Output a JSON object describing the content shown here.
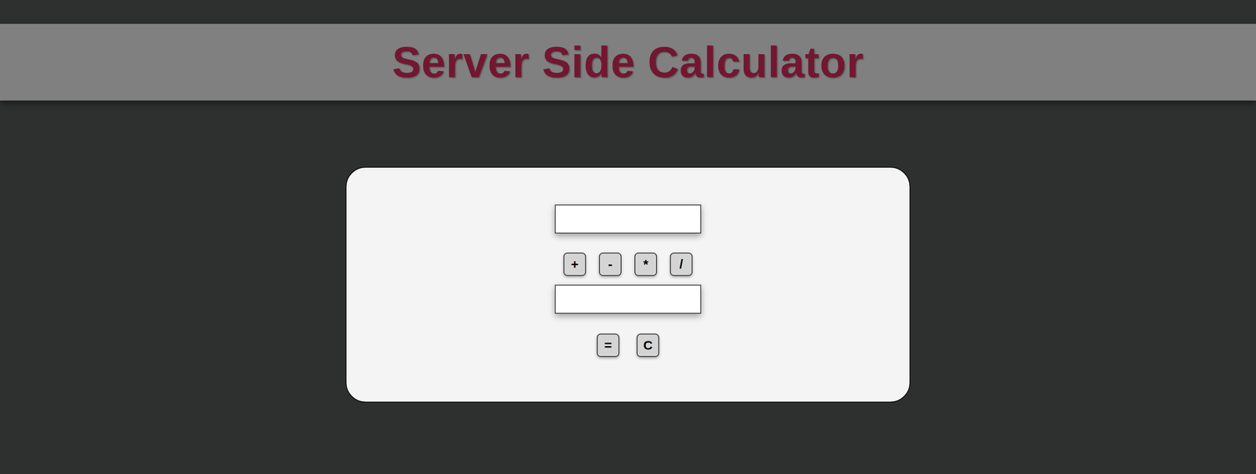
{
  "title": "Server Side Calculator",
  "inputs": [
    {
      "value": ""
    },
    {
      "value": ""
    }
  ],
  "operators": [
    "+",
    "-",
    "*",
    "/"
  ],
  "actions": [
    "=",
    "C"
  ]
}
